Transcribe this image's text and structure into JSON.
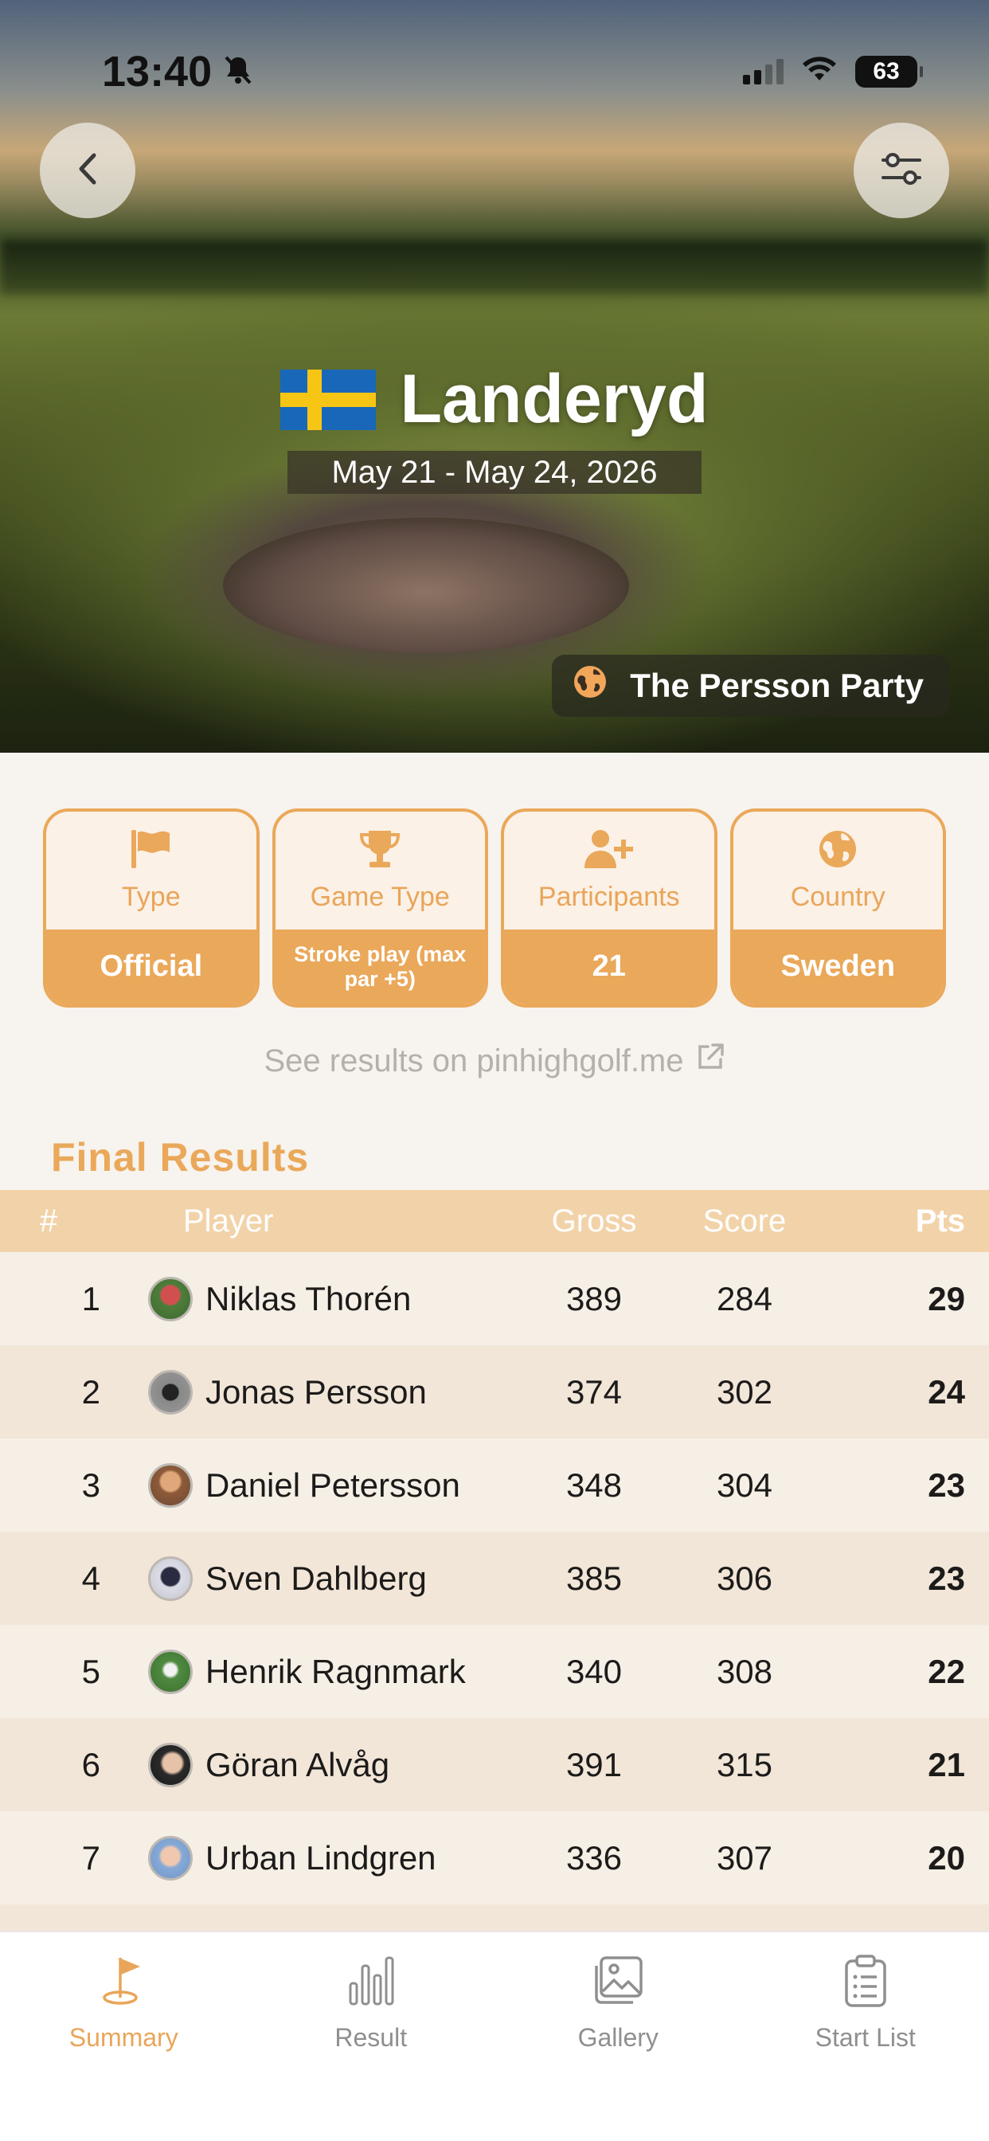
{
  "status_bar": {
    "time": "13:40",
    "battery": "63"
  },
  "hero": {
    "title": "Landeryd",
    "dates": "May 21 - May 24, 2026",
    "party": "The Persson Party",
    "flag_colors": {
      "blue": "#1967b9",
      "yellow": "#f7c514"
    }
  },
  "info_cards": [
    {
      "icon": "flag-icon",
      "label": "Type",
      "value": "Official"
    },
    {
      "icon": "trophy-icon",
      "label": "Game Type",
      "value": "Stroke play (max par +5)"
    },
    {
      "icon": "add-user-icon",
      "label": "Participants",
      "value": "21"
    },
    {
      "icon": "globe-icon",
      "label": "Country",
      "value": "Sweden"
    }
  ],
  "see_results": "See results on pinhighgolf.me",
  "results": {
    "title": "Final Results",
    "headers": {
      "rank": "#",
      "player": "Player",
      "gross": "Gross",
      "score": "Score",
      "pts": "Pts"
    },
    "rows": [
      {
        "rank": "1",
        "player": "Niklas Thorén",
        "gross": "389",
        "score": "284",
        "pts": "29"
      },
      {
        "rank": "2",
        "player": "Jonas Persson",
        "gross": "374",
        "score": "302",
        "pts": "24"
      },
      {
        "rank": "3",
        "player": "Daniel Petersson",
        "gross": "348",
        "score": "304",
        "pts": "23"
      },
      {
        "rank": "4",
        "player": "Sven Dahlberg",
        "gross": "385",
        "score": "306",
        "pts": "23"
      },
      {
        "rank": "5",
        "player": "Henrik Ragnmark",
        "gross": "340",
        "score": "308",
        "pts": "22"
      },
      {
        "rank": "6",
        "player": "Göran Alvåg",
        "gross": "391",
        "score": "315",
        "pts": "21"
      },
      {
        "rank": "7",
        "player": "Urban Lindgren",
        "gross": "336",
        "score": "307",
        "pts": "20"
      }
    ]
  },
  "tabs": [
    {
      "label": "Summary",
      "icon": "golf-flag-icon",
      "active": true
    },
    {
      "label": "Result",
      "icon": "bar-chart-icon",
      "active": false
    },
    {
      "label": "Gallery",
      "icon": "gallery-icon",
      "active": false
    },
    {
      "label": "Start List",
      "icon": "clipboard-list-icon",
      "active": false
    }
  ],
  "colors": {
    "accent": "#eaa85a",
    "header_row": "#f2d3a9",
    "row_odd": "#f6efe6",
    "row_even": "#f2e6d8",
    "tab_inactive": "#8f8f8f"
  }
}
